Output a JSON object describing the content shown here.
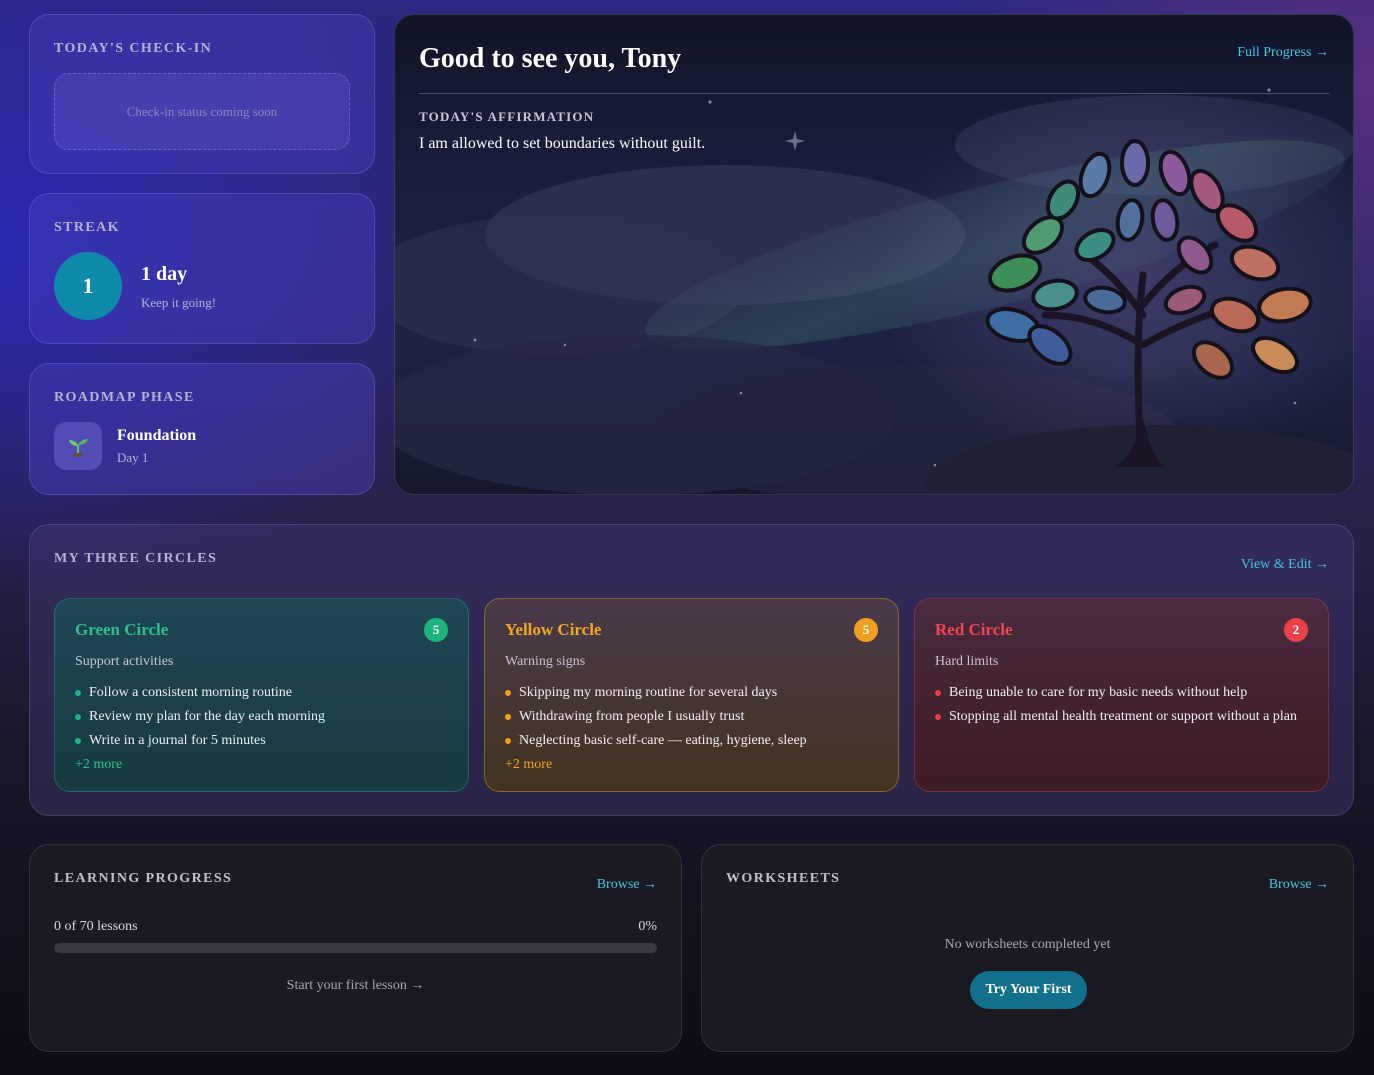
{
  "checkin": {
    "label": "TODAY'S CHECK-IN",
    "placeholder": "Check-in status coming soon"
  },
  "streak": {
    "label": "STREAK",
    "count": "1",
    "days": "1 day",
    "subtitle": "Keep it going!"
  },
  "roadmap": {
    "label": "ROADMAP PHASE",
    "icon": "seedling-icon",
    "phase": "Foundation",
    "day": "Day 1"
  },
  "hero": {
    "greeting": "Good to see you, Tony",
    "link": "Full Progress →",
    "affirmation_label": "TODAY'S AFFIRMATION",
    "affirmation": "I am allowed to set boundaries without guilt."
  },
  "circles": {
    "label": "MY THREE CIRCLES",
    "link": "View & Edit →",
    "green": {
      "title": "Green Circle",
      "count": "5",
      "desc": "Support activities",
      "items": [
        "Follow a consistent morning routine",
        "Review my plan for the day each morning",
        "Write in a journal for 5 minutes"
      ],
      "more": "+2 more",
      "color": "#2cc28a"
    },
    "yellow": {
      "title": "Yellow Circle",
      "count": "5",
      "desc": "Warning signs",
      "items": [
        "Skipping my morning routine for several days",
        "Withdrawing from people I usually trust",
        "Neglecting basic self-care — eating, hygiene, sleep"
      ],
      "more": "+2 more",
      "color": "#f2a623"
    },
    "red": {
      "title": "Red Circle",
      "count": "2",
      "desc": "Hard limits",
      "items": [
        "Being unable to care for my basic needs without help",
        "Stopping all mental health treatment or support without a plan"
      ],
      "color": "#f0474f"
    }
  },
  "learning": {
    "label": "LEARNING PROGRESS",
    "link": "Browse →",
    "lessons": "0 of 70 lessons",
    "percent": "0%",
    "progress": 0,
    "start": "Start your first lesson →"
  },
  "worksheets": {
    "label": "WORKSHEETS",
    "link": "Browse →",
    "empty": "No worksheets completed yet",
    "button": "Try Your First"
  },
  "colors": {
    "accent": "#46c4e0",
    "streak_circle": "#0f8aaa",
    "button": "#12708c"
  }
}
